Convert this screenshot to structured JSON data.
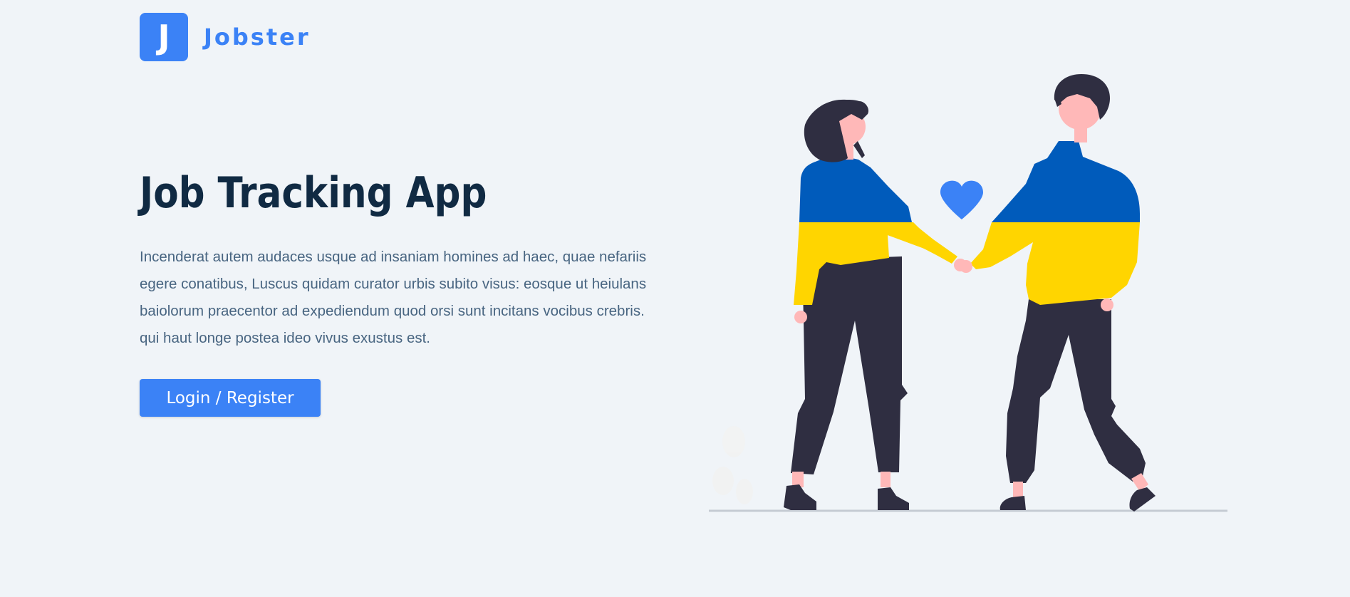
{
  "logo": {
    "mark": "J",
    "name": "Jobster"
  },
  "hero": {
    "title": "Job Tracking App",
    "description": "Incenderat autem audaces usque ad insaniam homines ad haec, quae nefariis egere conatibus, Luscus quidam curator urbis subito visus: eosque ut heiulans baiolorum praecentor ad expediendum quod orsi sunt incitans vocibus crebris. qui haut longe postea ideo vivus exustus est.",
    "button_label": "Login / Register"
  },
  "colors": {
    "primary": "#3b82f6",
    "title": "#102a43",
    "text": "#486581",
    "background": "#f0f4f8",
    "sweater_blue": "#005bbb",
    "sweater_yellow": "#ffd500"
  },
  "illustration": {
    "icons": [
      "heart-icon"
    ]
  }
}
